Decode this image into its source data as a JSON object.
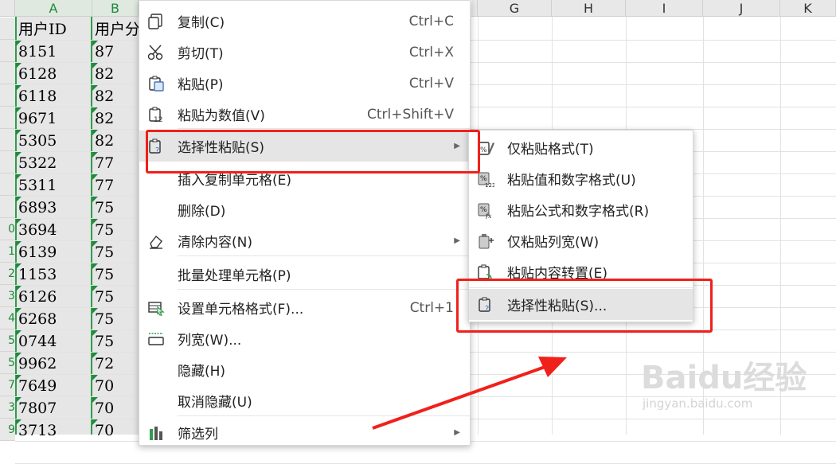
{
  "spreadsheet": {
    "columns": [
      "A",
      "B",
      "",
      "",
      "",
      "",
      "G",
      "H",
      "I",
      "J",
      "K"
    ],
    "header_row": [
      "用户ID",
      "用户分"
    ],
    "row_numbers": [
      "",
      "",
      "",
      "",
      "",
      "",
      "",
      "",
      "0",
      "1",
      "2",
      "3",
      "4",
      "5",
      "5",
      "7",
      "3",
      "9"
    ],
    "rows": [
      [
        "8151",
        "87"
      ],
      [
        "6128",
        "82"
      ],
      [
        "6118",
        "82"
      ],
      [
        "9671",
        "82"
      ],
      [
        "5305",
        "82"
      ],
      [
        "5322",
        "77"
      ],
      [
        "5311",
        "77"
      ],
      [
        "6893",
        "75"
      ],
      [
        "3694",
        "75"
      ],
      [
        "6139",
        "75"
      ],
      [
        "1153",
        "75"
      ],
      [
        "6126",
        "75"
      ],
      [
        "6268",
        "75"
      ],
      [
        "0744",
        "75"
      ],
      [
        "9962",
        "72"
      ],
      [
        "7649",
        "70"
      ],
      [
        "7807",
        "70"
      ],
      [
        "3713",
        "70"
      ]
    ]
  },
  "context_menu": {
    "items": [
      {
        "label": "复制(C)",
        "shortcut": "Ctrl+C",
        "icon": "copy-icon"
      },
      {
        "label": "剪切(T)",
        "shortcut": "Ctrl+X",
        "icon": "scissors-icon"
      },
      {
        "label": "粘贴(P)",
        "shortcut": "Ctrl+V",
        "icon": "paste-icon"
      },
      {
        "label": "粘贴为数值(V)",
        "shortcut": "Ctrl+Shift+V",
        "icon": "paste-values-icon"
      },
      {
        "label": "选择性粘贴(S)",
        "shortcut": "",
        "icon": "paste-special-icon",
        "submenu": true
      },
      {
        "label": "插入复制单元格(E)",
        "shortcut": "",
        "icon": ""
      },
      {
        "label": "删除(D)",
        "shortcut": "",
        "icon": ""
      },
      {
        "label": "清除内容(N)",
        "shortcut": "",
        "icon": "eraser-icon",
        "submenu": true
      },
      {
        "label": "批量处理单元格(P)",
        "shortcut": "",
        "icon": ""
      },
      {
        "label": "设置单元格格式(F)...",
        "shortcut": "Ctrl+1",
        "icon": "format-cells-icon"
      },
      {
        "label": "列宽(W)...",
        "shortcut": "",
        "icon": "column-width-icon"
      },
      {
        "label": "隐藏(H)",
        "shortcut": "",
        "icon": ""
      },
      {
        "label": "取消隐藏(U)",
        "shortcut": "",
        "icon": ""
      },
      {
        "label": "筛选列",
        "shortcut": "",
        "icon": "filter-icon",
        "submenu": true
      }
    ]
  },
  "submenu": {
    "items": [
      {
        "label": "仅粘贴格式(T)",
        "icon": "paste-format-icon"
      },
      {
        "label": "粘贴值和数字格式(U)",
        "icon": "paste-values-number-icon"
      },
      {
        "label": "粘贴公式和数字格式(R)",
        "icon": "paste-formula-icon"
      },
      {
        "label": "仅粘贴列宽(W)",
        "icon": "paste-column-width-icon"
      },
      {
        "label": "粘贴内容转置(E)",
        "icon": "paste-transpose-icon"
      },
      {
        "label": "选择性粘贴(S)...",
        "icon": "paste-special-icon"
      }
    ]
  },
  "watermark": {
    "text": "Baidu经验",
    "url": "jingyan.baidu.com"
  },
  "colors": {
    "highlight_red": "#f0201b",
    "selection_green": "#2e9e4a",
    "arrow_red": "#f0201b"
  }
}
